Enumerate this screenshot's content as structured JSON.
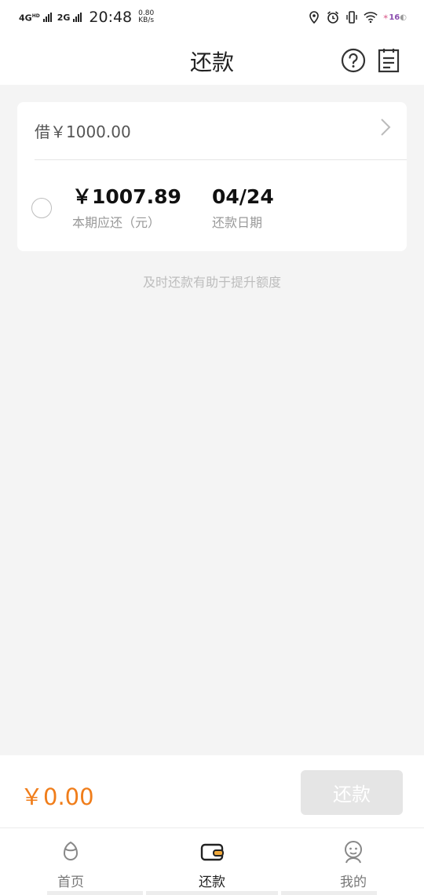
{
  "status_bar": {
    "network_1": "4G",
    "network_1_sup": "HD",
    "network_2": "2G",
    "time": "20:48",
    "speed_value": "0.80",
    "speed_unit": "KB/s",
    "battery": "16"
  },
  "header": {
    "title": "还款",
    "help_icon": "question-circle-icon",
    "record_icon": "document-list-icon"
  },
  "loan_card": {
    "borrow_text": "借￥1000.00",
    "installment": {
      "amount": "￥1007.89",
      "amount_label": "本期应还（元）",
      "due_date": "04/24",
      "due_date_label": "还款日期",
      "selected": false
    }
  },
  "tip": "及时还款有助于提升额度",
  "pay_bar": {
    "total": "￥0.00",
    "pay_button": "还款",
    "total_color": "#f07d1a"
  },
  "tab_bar": {
    "tabs": [
      {
        "label": "首页",
        "icon": "home-leaf-icon",
        "active": false
      },
      {
        "label": "还款",
        "icon": "wallet-icon",
        "active": true
      },
      {
        "label": "我的",
        "icon": "profile-face-icon",
        "active": false
      }
    ]
  },
  "colors": {
    "accent": "#f07d1a",
    "background": "#f4f4f4",
    "disabled_button": "#e5e5e5"
  }
}
